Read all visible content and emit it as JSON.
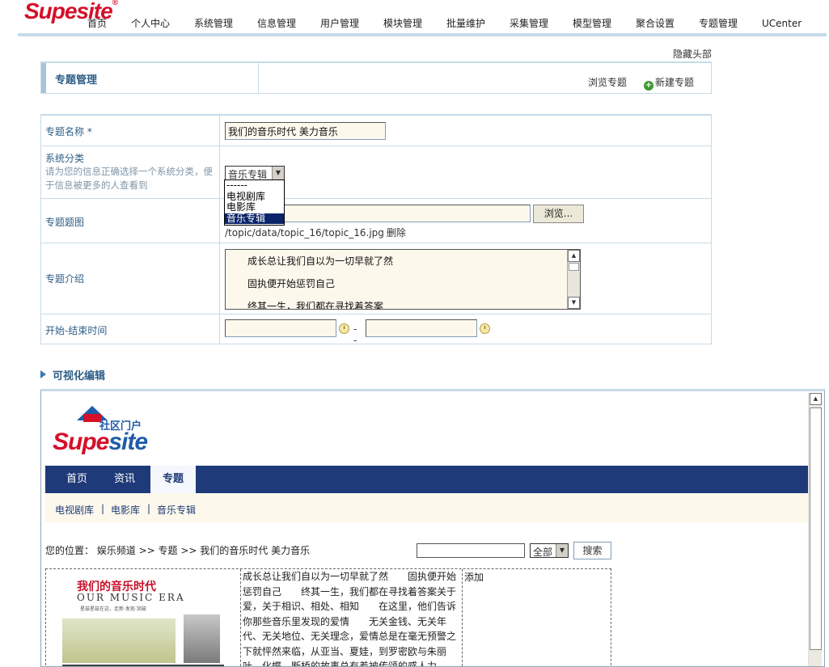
{
  "brand": {
    "logo_text": "Supesite",
    "logo_mark": "®"
  },
  "top_nav": [
    "首页",
    "个人中心",
    "系统管理",
    "信息管理",
    "用户管理",
    "模块管理",
    "批量维护",
    "采集管理",
    "模型管理",
    "聚合设置",
    "专题管理",
    "UCenter"
  ],
  "hide_header": "隐藏头部",
  "panel": {
    "title": "专题管理",
    "browse": "浏览专题",
    "new": "新建专题"
  },
  "form": {
    "name": {
      "label": "专题名称 *",
      "value": "我们的音乐时代 美力音乐"
    },
    "category": {
      "label": "系统分类",
      "hint": "请为您的信息正确选择一个系统分类，便于信息被更多的人查看到",
      "selected": "音乐专辑",
      "options": [
        "------",
        "电视剧库",
        "电影库",
        "音乐专辑"
      ]
    },
    "image": {
      "label": "专题题图",
      "value": "",
      "browse_button": "浏览...",
      "path": "/topic/data/topic_16/topic_16.jpg",
      "delete": "删除"
    },
    "intro": {
      "label": "专题介绍",
      "lines": [
        "成长总让我们自以为一切早就了然",
        "固执便开始惩罚自己",
        "终其一生，我们都在寻找着答案"
      ]
    },
    "time": {
      "label": "开始-结束时间",
      "start": "",
      "end": "",
      "separator": "--"
    }
  },
  "visual_edit": {
    "title": "可视化编辑",
    "preview": {
      "logo_cn": "社区门户",
      "logo_sup": "Supe",
      "logo_site": "site",
      "nav": [
        "首页",
        "资讯",
        "专题"
      ],
      "subnav": [
        "电视剧库",
        "电影库",
        "音乐专辑"
      ],
      "subnav_sep": "|",
      "breadcrumb": "您的位置： 娱乐频道 >> 专题 >> 我们的音乐时代 美力音乐",
      "search_value": "",
      "search_scope": "全部",
      "search_button": "搜索",
      "banner_title": "我们的音乐时代",
      "banner_subtitle": "OUR MUSIC ERA",
      "banner_small": "星兹星兹在这，走新·发现·突破",
      "body_text": "成长总让我们自以为一切早就了然　　固执便开始惩罚自己　　终其一生，我们都在寻找着答案关于爱，关于相识、相处、相知　　在这里，他们告诉你那些音乐里发现的爱情　　无关金钱、无关年代、无关地位、无关理念，爱情总是在毫无预警之下就怦然来临，从亚当、夏娃，到罗密欧与朱丽叶，化蝶、断桥的故事总有着被传颂的感人力",
      "add_label": "添加"
    }
  }
}
